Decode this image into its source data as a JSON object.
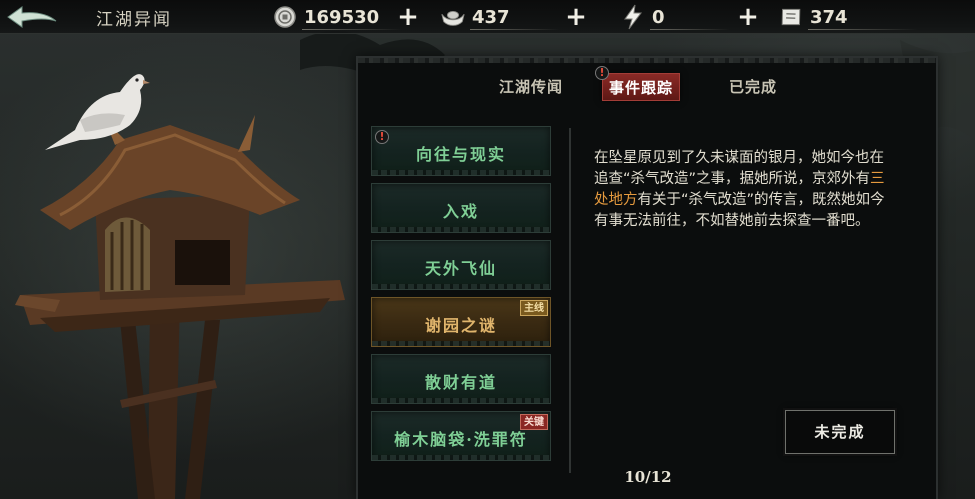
{
  "header": {
    "title": "江湖异闻",
    "back_icon": "back-arrow-icon"
  },
  "resources": [
    {
      "icon": "coin-icon",
      "value": "169530"
    },
    {
      "icon": "silver-ingot-icon",
      "value": "437"
    },
    {
      "icon": "lightning-icon",
      "value": "0"
    },
    {
      "icon": "ticket-icon",
      "value": "374"
    }
  ],
  "plus_label": "+",
  "tabs": [
    {
      "label": "江湖传闻",
      "active": false
    },
    {
      "label": "事件跟踪",
      "active": true,
      "alert": "!"
    },
    {
      "label": "已完成",
      "active": false
    }
  ],
  "quest_list": {
    "items": [
      {
        "label": "向往与现实",
        "selected": false,
        "alert": "!"
      },
      {
        "label": "入戏",
        "selected": false
      },
      {
        "label": "天外飞仙",
        "selected": false
      },
      {
        "label": "谢园之谜",
        "selected": true,
        "badge": "主线"
      },
      {
        "label": "散财有道",
        "selected": false
      },
      {
        "label": "榆木脑袋·洗罪符",
        "selected": false,
        "badge": "关键"
      }
    ]
  },
  "detail": {
    "paragraph": [
      {
        "text": "在坠星原见到了久未谋面的银月，她如今也在追查“杀气改造”之事，据她所说，京郊外有",
        "highlight": false
      },
      {
        "text": "三处地方",
        "highlight": true
      },
      {
        "text": "有关于“杀气改造”的传言，既然她如今有事无法前往，不如替她前去探查一番吧。",
        "highlight": false
      }
    ]
  },
  "status_button": {
    "label": "未完成"
  },
  "pager": {
    "text": "10/12"
  },
  "colors": {
    "active_tab": "#8a2a26",
    "quest_text": "#7fcf95",
    "selected_quest_text": "#e0b56c",
    "highlight_text": "#e59a3e"
  }
}
